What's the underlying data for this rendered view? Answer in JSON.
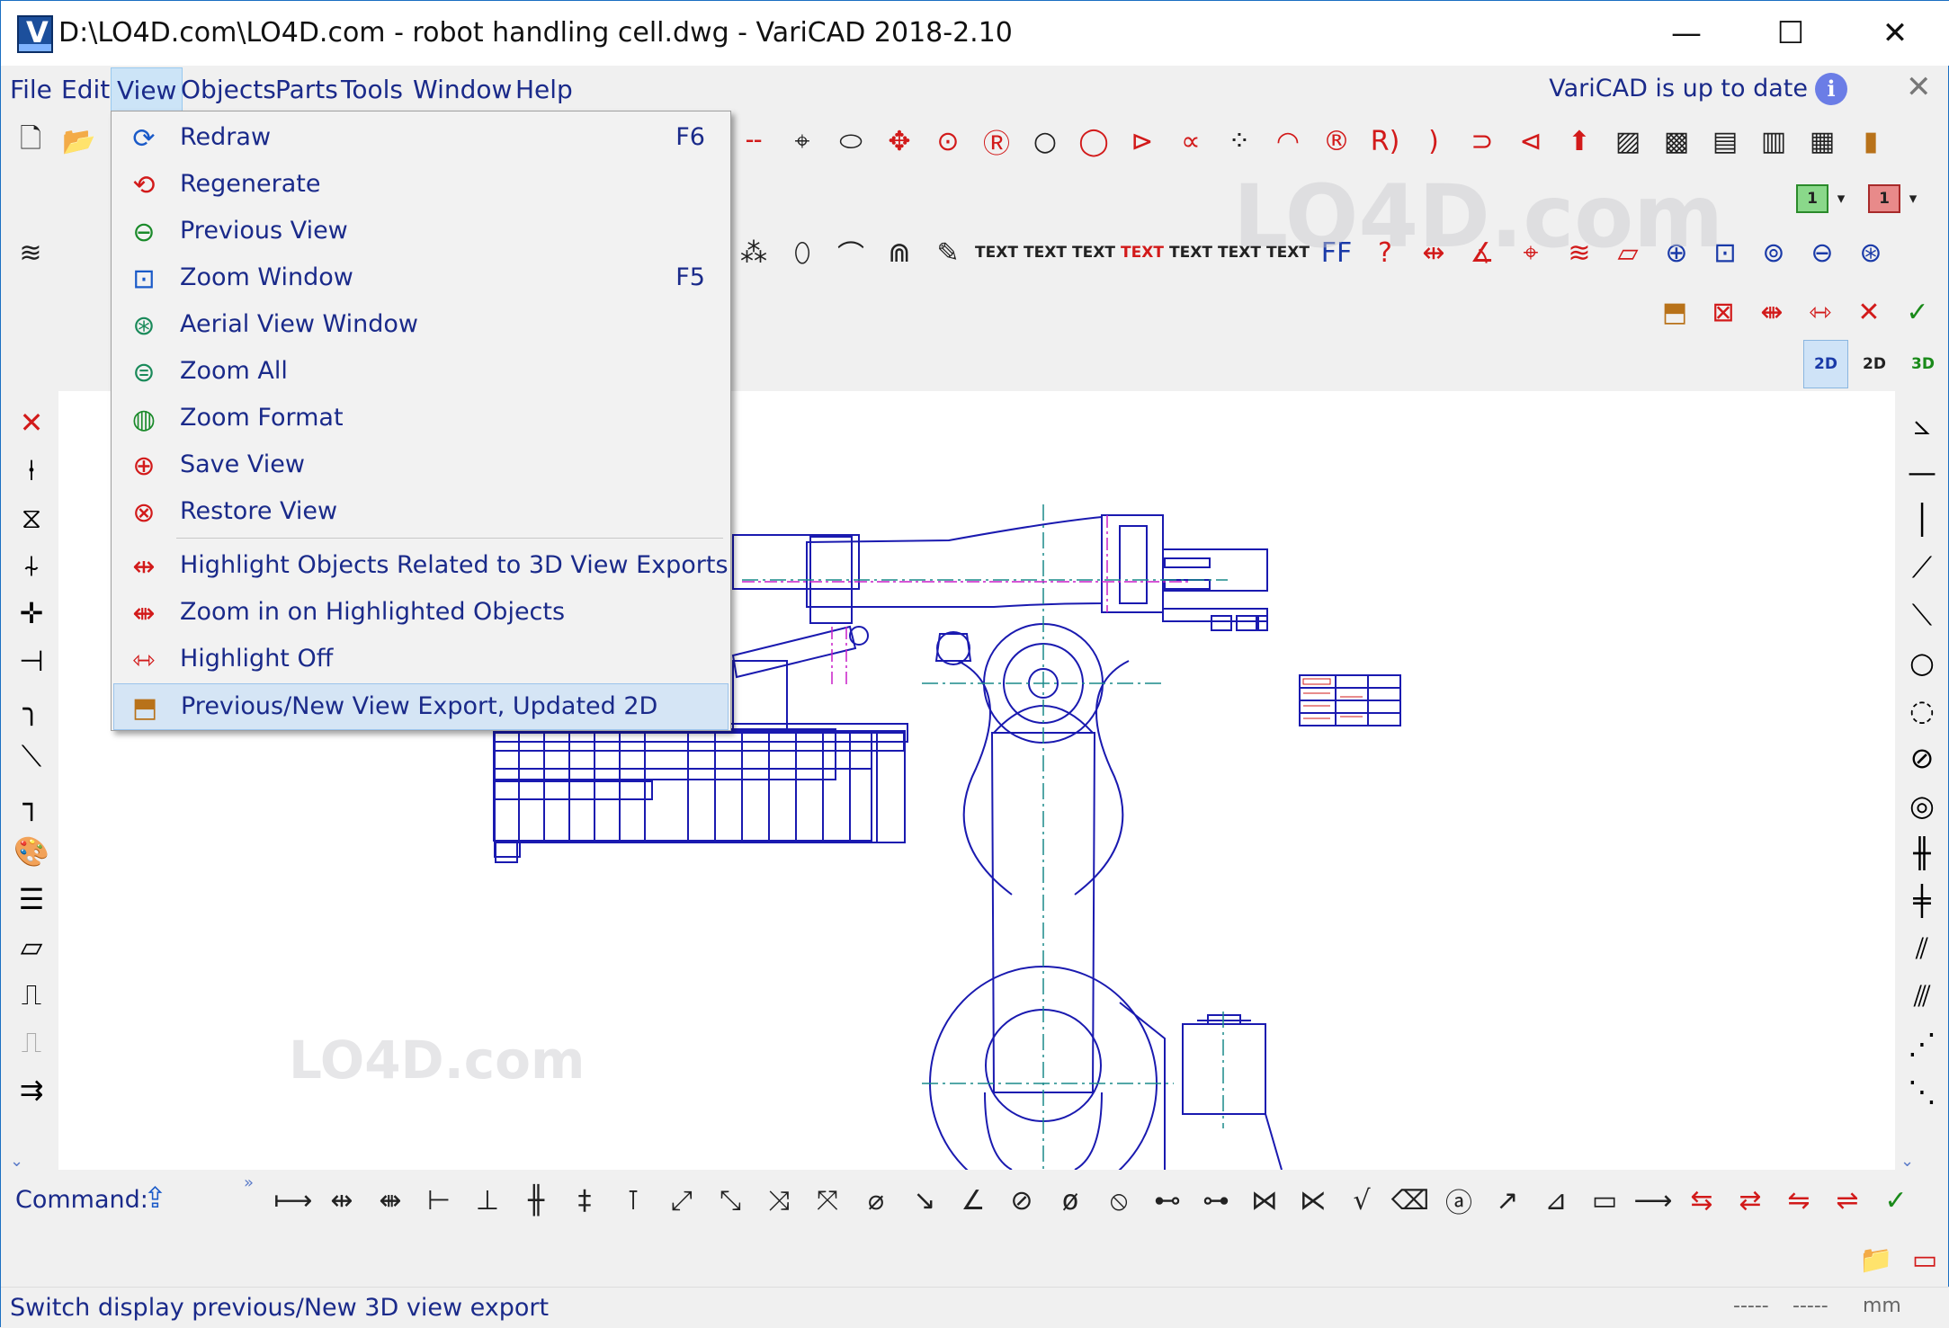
{
  "window": {
    "title": "D:\\LO4D.com\\LO4D.com - robot handling cell.dwg - VariCAD 2018-2.10",
    "minimize": "—",
    "maximize": "☐",
    "close": "✕"
  },
  "menubar": {
    "items": [
      "File",
      "Edit",
      "View",
      "Objects",
      "Parts",
      "Tools",
      "Window",
      "Help"
    ],
    "active": "View",
    "update_text": "VariCAD is up to date",
    "info_glyph": "i",
    "panel_close": "✕"
  },
  "view_menu": {
    "items": [
      {
        "label": "Redraw",
        "shortcut": "F6",
        "icon": "redraw-icon"
      },
      {
        "label": "Regenerate",
        "shortcut": "",
        "icon": "regenerate-icon"
      },
      {
        "label": "Previous View",
        "shortcut": "",
        "icon": "previous-view-icon"
      },
      {
        "label": "Zoom Window",
        "shortcut": "F5",
        "icon": "zoom-window-icon"
      },
      {
        "label": "Aerial View Window",
        "shortcut": "",
        "icon": "aerial-view-icon"
      },
      {
        "label": "Zoom All",
        "shortcut": "",
        "icon": "zoom-all-icon"
      },
      {
        "label": "Zoom Format",
        "shortcut": "",
        "icon": "zoom-format-icon"
      },
      {
        "label": "Save View",
        "shortcut": "",
        "icon": "save-view-icon"
      },
      {
        "label": "Restore View",
        "shortcut": "",
        "icon": "restore-view-icon"
      },
      {
        "label": "Highlight Objects Related to 3D View Exports",
        "shortcut": "",
        "icon": "highlight-objects-icon"
      },
      {
        "label": "Zoom in on Highlighted Objects",
        "shortcut": "",
        "icon": "zoom-highlighted-icon"
      },
      {
        "label": "Highlight Off",
        "shortcut": "",
        "icon": "highlight-off-icon"
      },
      {
        "label": "Previous/New View Export, Updated 2D",
        "shortcut": "",
        "icon": "view-export-icon"
      }
    ],
    "highlighted_index": 12
  },
  "toolbar": {
    "text_labels": [
      "TEXT",
      "TEXT",
      "TEXT",
      "TEXT",
      "TEXT",
      "TEXT",
      "TEXT"
    ],
    "mode_2d": "2D",
    "mode_2d_b": "2D",
    "mode_3d": "3D",
    "layer_1": "1",
    "layer_1b": "1"
  },
  "command": {
    "label": "Command:",
    "more": "»"
  },
  "status": {
    "text": "Switch display previous/New 3D view export",
    "cell_a": "-----",
    "cell_b": "-----",
    "units": "mm"
  },
  "watermark": {
    "logo_text": "LO4D.com"
  },
  "colors": {
    "menu_text": "#1a2a8a",
    "drawing_line": "#1a1ab0",
    "centerline": "#1a8a8a",
    "magenta": "#c81ec8",
    "highlight": "#d5e5f5",
    "accent_red": "#d21a1a"
  }
}
